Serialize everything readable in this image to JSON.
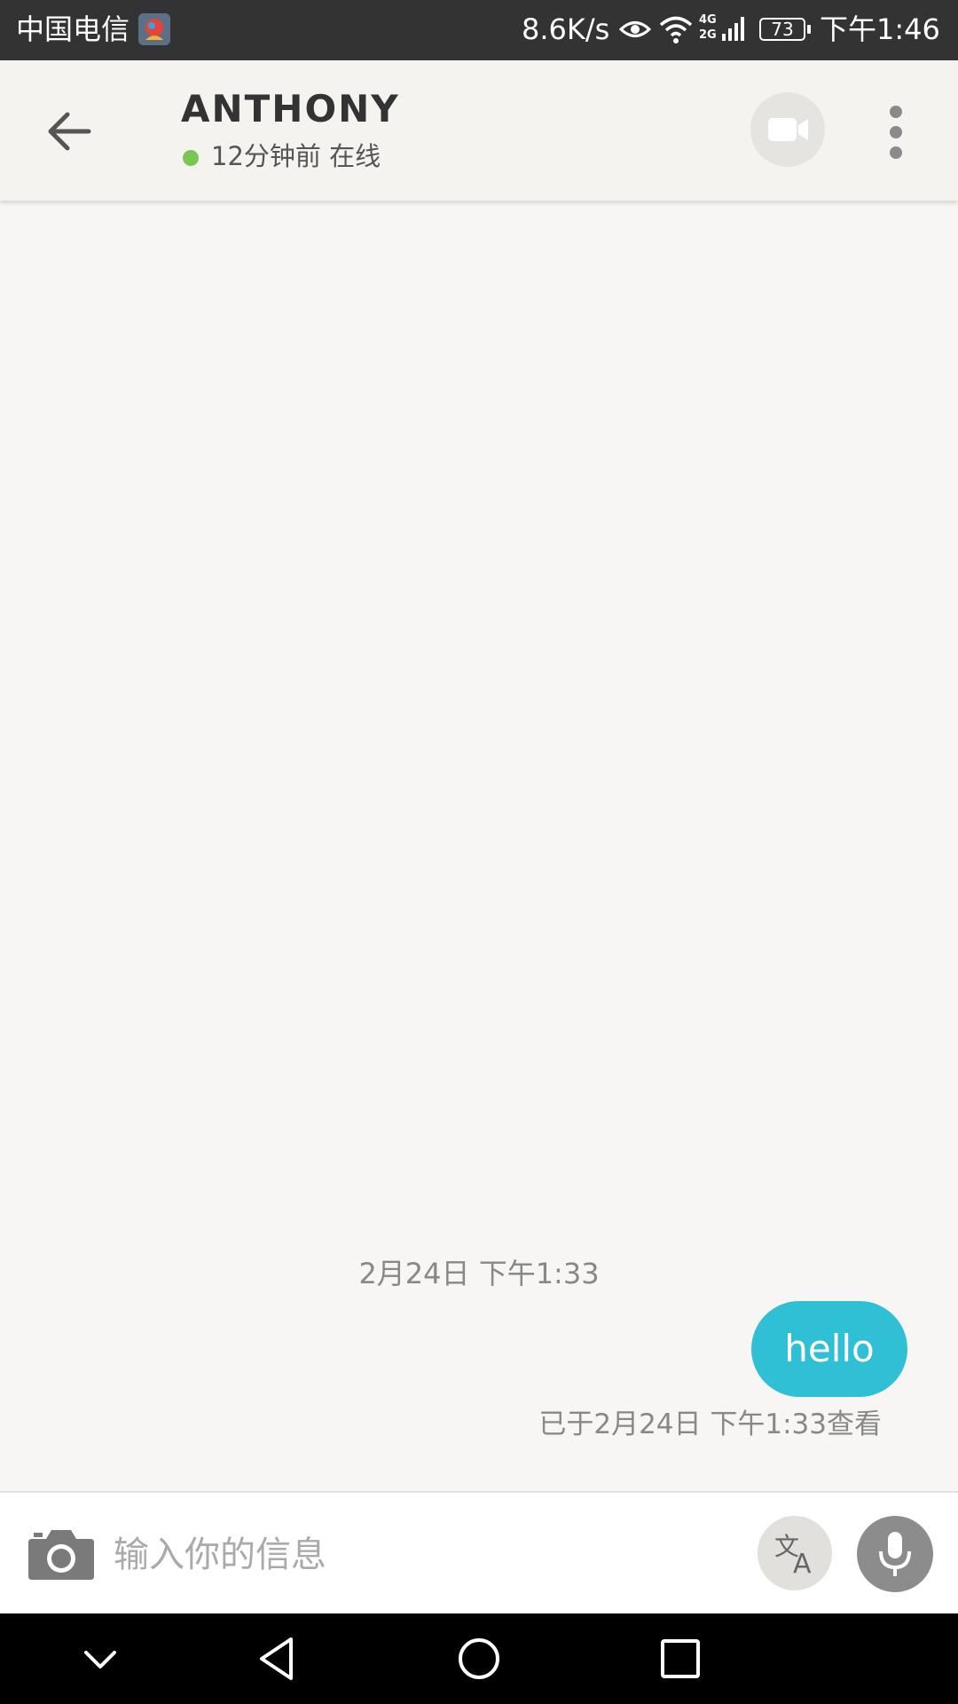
{
  "status_bar": {
    "carrier": "中国电信",
    "network_speed": "8.6K/s",
    "network_type": "4G 2G",
    "battery": "73",
    "time": "下午1:46"
  },
  "header": {
    "contact_name": "ANTHONY",
    "online_status": "12分钟前 在线",
    "online_color": "#7ac655"
  },
  "chat": {
    "date_label": "2月24日 下午1:33",
    "messages": [
      {
        "text": "hello",
        "bubble_color": "#2fc0d6",
        "outgoing": true
      }
    ],
    "read_receipt": "已于2月24日 下午1:33查看"
  },
  "input_bar": {
    "placeholder": "输入你的信息",
    "value": ""
  },
  "icons": {
    "back": "arrow-left-icon",
    "video": "video-camera-icon",
    "more": "more-vertical-icon",
    "camera": "camera-icon",
    "translate": "translate-icon",
    "mic": "microphone-icon"
  }
}
